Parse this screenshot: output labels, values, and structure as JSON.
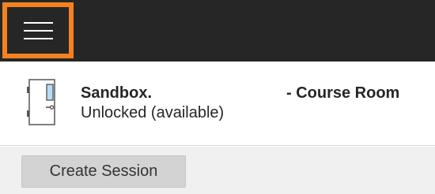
{
  "header": {
    "menu_icon": "hamburger-menu-icon",
    "menu_highlight_color": "#f5821f",
    "background_color": "#262626"
  },
  "room": {
    "icon": "door-icon",
    "name": "Sandbox.",
    "type": "- Course Room",
    "status": "Unlocked (available)"
  },
  "actions": {
    "create_session_label": "Create Session"
  }
}
